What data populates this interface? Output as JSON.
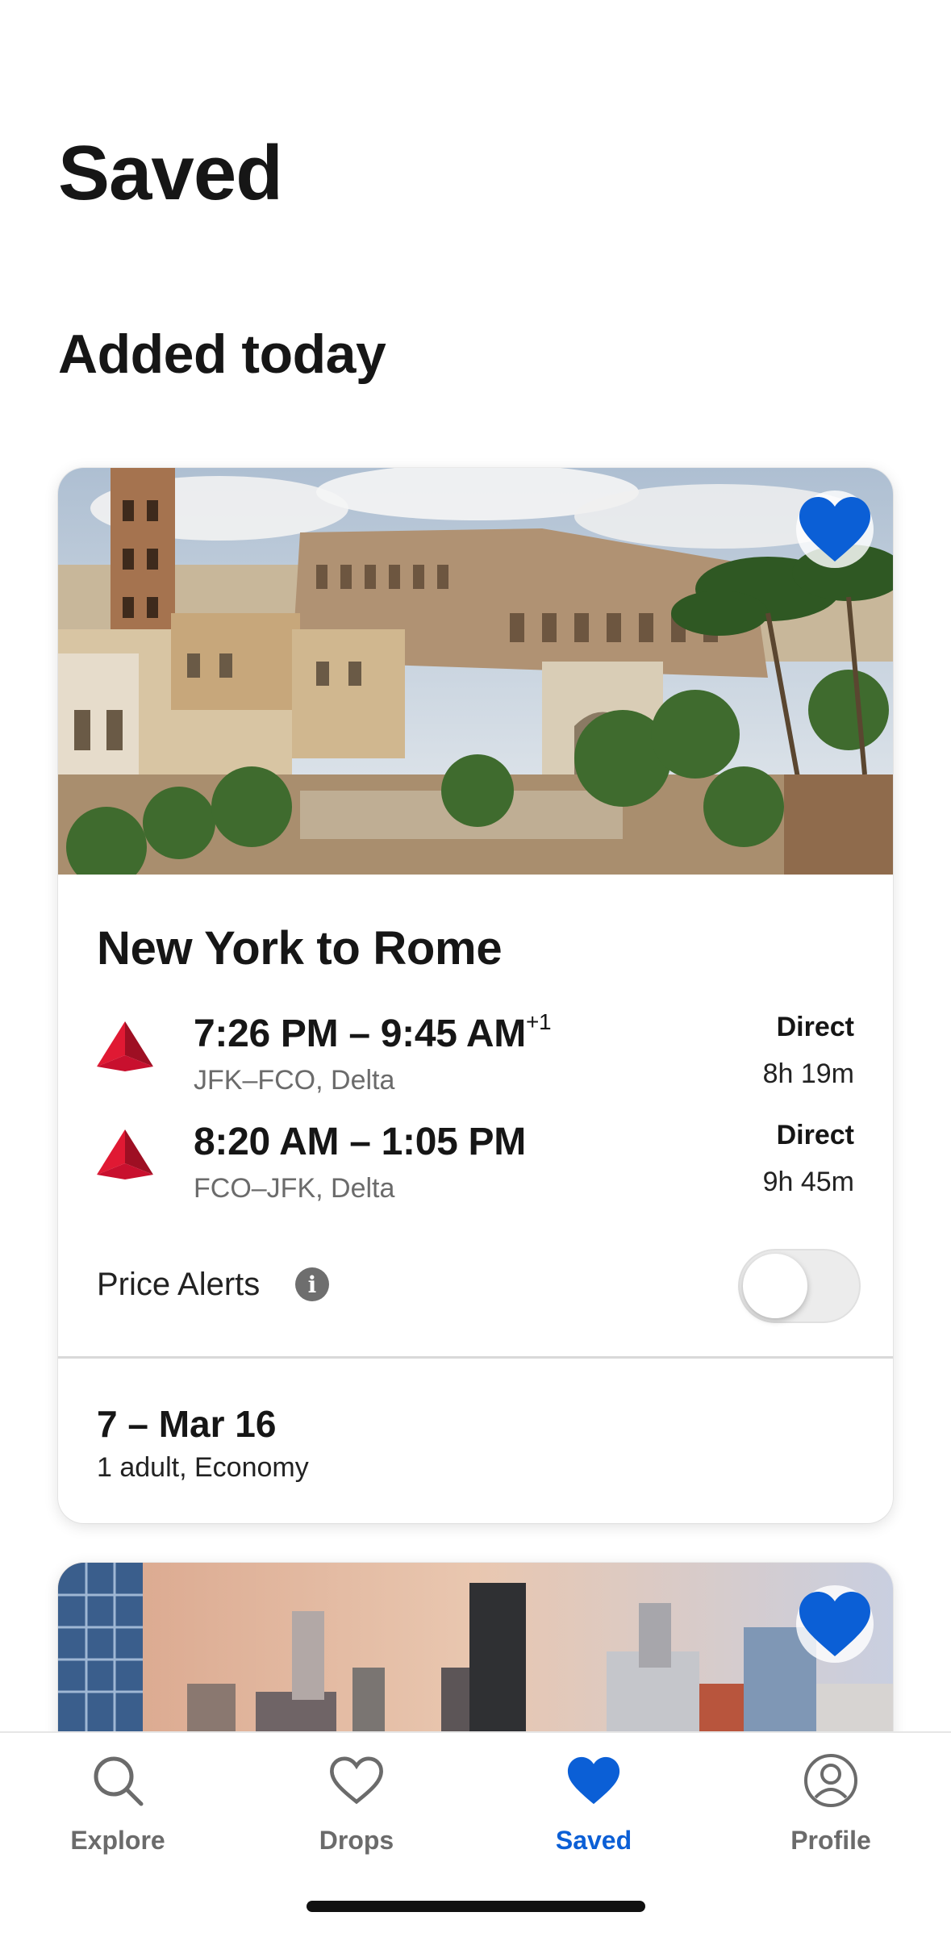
{
  "page": {
    "title": "Saved",
    "section": "Added today"
  },
  "colors": {
    "accent": "#0b5fd6",
    "airline": "#c8102e"
  },
  "cards": [
    {
      "route": "New York to Rome",
      "saved": true,
      "flights": [
        {
          "times": "7:26 PM – 9:45 AM",
          "day_offset": "+1",
          "airports": "JFK–FCO, Delta",
          "stops": "Direct",
          "duration": "8h 19m",
          "logo": "delta-logo-icon"
        },
        {
          "times": "8:20 AM – 1:05 PM",
          "day_offset": "",
          "airports": "FCO–JFK, Delta",
          "stops": "Direct",
          "duration": "9h 45m",
          "logo": "delta-logo-icon"
        }
      ],
      "price_alerts": {
        "label": "Price Alerts",
        "info": "i",
        "enabled": false
      },
      "dates": "7 – Mar 16",
      "passengers": "1 adult, Economy"
    },
    {
      "saved": true
    }
  ],
  "tabbar": {
    "tabs": [
      {
        "label": "Explore",
        "icon": "search-icon",
        "active": false
      },
      {
        "label": "Drops",
        "icon": "heart-outline-icon",
        "active": false
      },
      {
        "label": "Saved",
        "icon": "heart-filled-icon",
        "active": true
      },
      {
        "label": "Profile",
        "icon": "profile-icon",
        "active": false
      }
    ]
  }
}
